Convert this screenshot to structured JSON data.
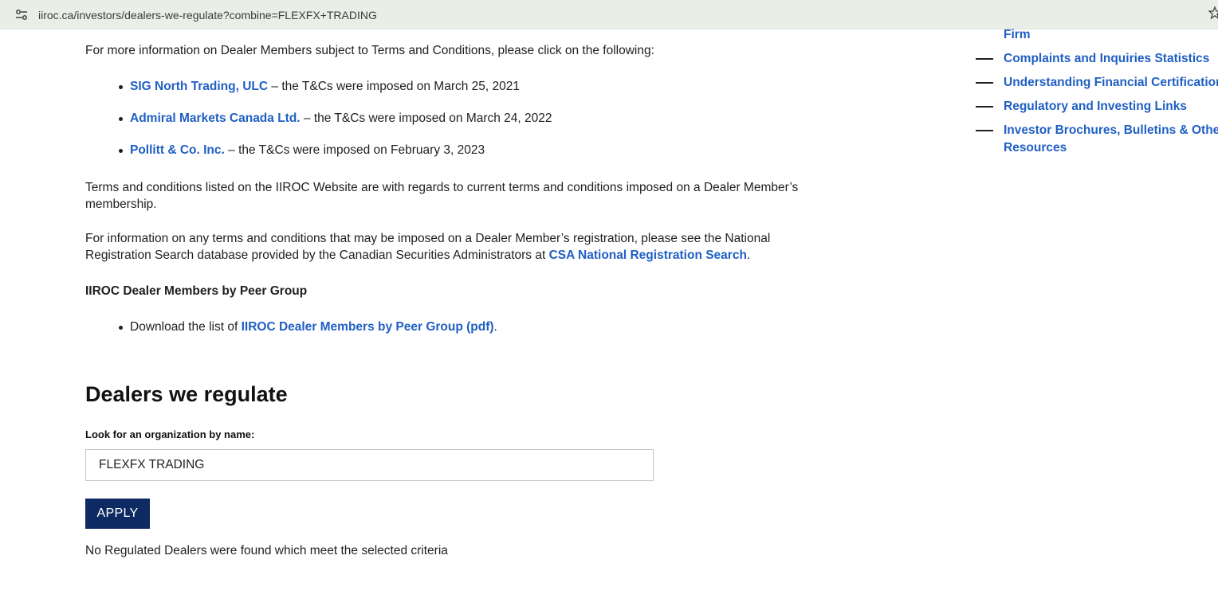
{
  "browser": {
    "url": "iiroc.ca/investors/dealers-we-regulate?combine=FLEXFX+TRADING",
    "site_info_icon": "tune-icon",
    "bookmark_icon": "star-icon"
  },
  "content": {
    "intro": "For more information on Dealer Members subject to Terms and Conditions, please click on the following:",
    "tc_items": [
      {
        "name": "SIG North Trading, ULC",
        "text": " – the T&Cs were imposed on March 25, 2021"
      },
      {
        "name": "Admiral Markets Canada Ltd.",
        "text": " – the T&Cs were imposed on March 24, 2022"
      },
      {
        "name": "Pollitt & Co. Inc.",
        "text": " – the T&Cs were imposed on February 3, 2023"
      }
    ],
    "terms_note": "Terms and conditions listed on the IIROC Website are with regards to current terms and conditions imposed on a Dealer Member’s membership.",
    "registration_note_pre": "For information on any terms and conditions that may be imposed on a Dealer Member’s registration, please see the National Registration Search database provided by the Canadian Securities Administrators at ",
    "registration_link": "CSA National Registration Search",
    "registration_note_post": ".",
    "peer_group_heading": "IIROC Dealer Members by Peer Group",
    "download_pre": "Download the list of ",
    "download_link": "IIROC Dealer Members by Peer Group (pdf)",
    "download_post": ".",
    "dealers_heading": "Dealers we regulate",
    "lookup_label": "Look for an organization by name:",
    "search_value": "FLEXFX TRADING",
    "apply_label": "APPLY",
    "no_results": "No Regulated Dealers were found which meet the selected criteria"
  },
  "sidebar": {
    "items": [
      {
        "label": "Firm"
      },
      {
        "label": "Complaints and Inquiries Statistics"
      },
      {
        "label": "Understanding Financial Certifications"
      },
      {
        "label": "Regulatory and Investing Links"
      },
      {
        "label": "Investor Brochures, Bulletins & Other",
        "label2": "Resources"
      }
    ]
  },
  "colors": {
    "link": "#1f5fc4",
    "button": "#0e2a63",
    "address_bar": "#e9eee6"
  }
}
